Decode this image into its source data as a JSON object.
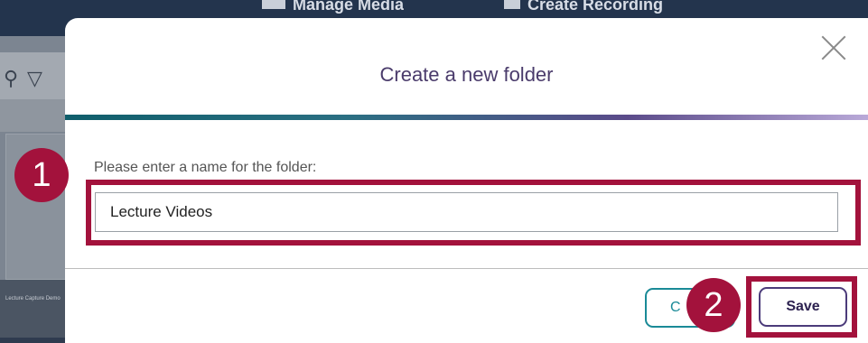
{
  "background": {
    "top_labels": [
      "Manage Media",
      "Create Recording"
    ],
    "thumb_caption": "Lecture Capture Demo"
  },
  "modal": {
    "title": "Create a new folder",
    "field_label": "Please enter a name for the folder:",
    "folder_name_value": "Lecture Videos",
    "cancel_label": "C",
    "save_label": "Save",
    "close_icon": "close-icon"
  },
  "annotations": {
    "step_1": "1",
    "step_2": "2",
    "highlight_color": "#a3123c"
  },
  "colors": {
    "title_text": "#4a3b6b",
    "accent_teal": "#1a8a97",
    "accent_purple": "#4b3b7a"
  }
}
